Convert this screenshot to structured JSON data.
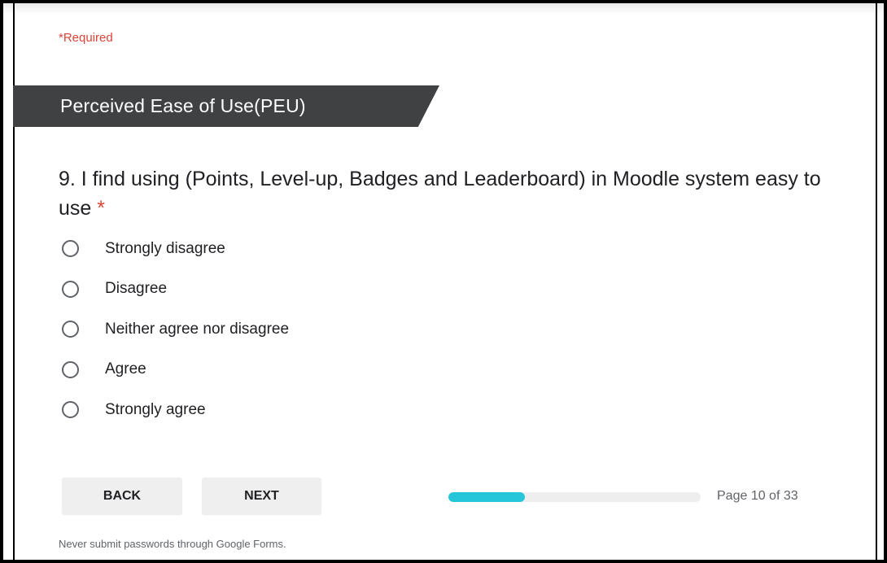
{
  "form": {
    "required_note": "*Required"
  },
  "section": {
    "title": "Perceived Ease of Use(PEU)"
  },
  "question": {
    "text": "9. I find using (Points, Level-up, Badges and Leaderboard) in Moodle system easy to use",
    "required_marker": "*",
    "options": [
      {
        "label": "Strongly disagree"
      },
      {
        "label": "Disagree"
      },
      {
        "label": "Neither agree nor disagree"
      },
      {
        "label": "Agree"
      },
      {
        "label": "Strongly agree"
      }
    ]
  },
  "navigation": {
    "back_label": "BACK",
    "next_label": "NEXT"
  },
  "progress": {
    "fraction": 0.303,
    "page_text": "Page 10 of 33"
  },
  "footer": {
    "note": "Never submit passwords through Google Forms."
  },
  "colors": {
    "accent": "#26c6da",
    "required": "#db4437",
    "banner": "#3f4143"
  }
}
